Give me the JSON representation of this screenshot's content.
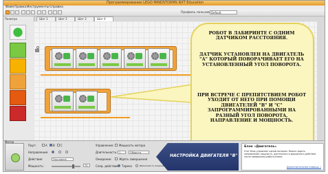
{
  "window": {
    "title": "Программирование LEGO MINDSTORMS NXT Education"
  },
  "menu": {
    "items": [
      "Файл",
      "Правка",
      "Инструменты",
      "Справка"
    ]
  },
  "toolbar": {
    "profile_label": "Профиль пользователя:",
    "profile_value": "Default"
  },
  "palette": {
    "label": "Палитра"
  },
  "tabs": [
    "Шаг 1",
    "Шаг 2",
    "Шаг 3",
    "Шаг 4"
  ],
  "callout": {
    "paragraphs": [
      "РОБОТ В ЛАБИРИНТЕ С ОДНИМ ДАТЧИКОМ РАССТОЯНИЯ.",
      "ДАТЧИК УСТАНОВЛЕН НА ДВИГАТЕЛЬ \"А\" КОТОРЫЙ ПОВОРАЧИВАЕТ ЕГО НА УСТАНОВЛЕННЫЙ УГОЛ ПОВОРОТА.",
      "ПРИ ВСТРЕЧЕ С ПРЕПЯТСТВИЕМ РОБОТ УХОДИТ ОТ НЕГО ПРИ ПОМОЩИ ДВИГАТЕЛЕЙ \"В\" И \"С\" ЗАПРОГРАММИРОВАННЫМИ НА РАЗНЫЙ УГОЛ ПОВОРОТА, НАПРАВЛЕНИЕ И МОЩНОСТЬ."
    ]
  },
  "config": {
    "motor_label": "Мотор",
    "port_label": "Порт:",
    "ports": [
      "A",
      "B",
      "C"
    ],
    "direction_label": "Направление:",
    "action_label": "Действие:",
    "action_value": "Постоянно",
    "power_label": "Мощность:",
    "power_value": "75",
    "control_label": "Управление:",
    "control_option": "Мощность мотора",
    "duration_label": "Длительность:",
    "duration_value": "1",
    "duration_unit": "Обороты",
    "wait_label": "Ожидание:",
    "wait_option": "Ждать завершения",
    "next_action_label": "След. действие:",
    "next_action_brake": "Тормоз",
    "next_action_coast": "Движение по инерции"
  },
  "banner": {
    "text": "НАСТРОЙКА ДВИГАТЕЛЯ \"В\""
  },
  "help": {
    "title": "Блок «Двигатель»",
    "body": "Этот блок управляет одним мотором. Можно задать направление, мощность, длительность вращения и действие после завершения работы блока.",
    "link": "Дополнительная помощь »"
  },
  "colors": {
    "accent_orange": "#f0a23a",
    "callout_bg": "#fbf5bf",
    "banner_bg": "#2e427a"
  }
}
